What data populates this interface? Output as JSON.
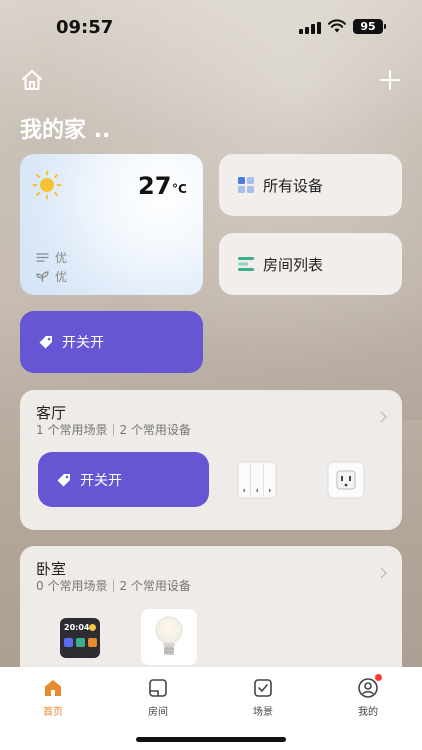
{
  "status_bar": {
    "time": "09:57",
    "battery": "95"
  },
  "header": {
    "title": "我的家 .."
  },
  "weather": {
    "temperature": "27",
    "unit": "°C",
    "air_quality": "优",
    "humidity_quality": "优"
  },
  "tiles": {
    "all_devices": "所有设备",
    "room_list": "房间列表"
  },
  "scene": {
    "label": "开关开"
  },
  "rooms": [
    {
      "name": "客厅",
      "subtitle": "1 个常用场景｜2 个常用设备",
      "scene_label": "开关开"
    },
    {
      "name": "卧室",
      "subtitle": "0 个常用场景｜2 个常用设备",
      "panel_time": "20:04"
    }
  ],
  "tabbar": {
    "home": "首页",
    "rooms": "房间",
    "scenes": "场景",
    "mine": "我的"
  },
  "colors": {
    "accent": "#6656d4",
    "active_tab": "#e88a2e",
    "badge": "#ff3b30"
  }
}
